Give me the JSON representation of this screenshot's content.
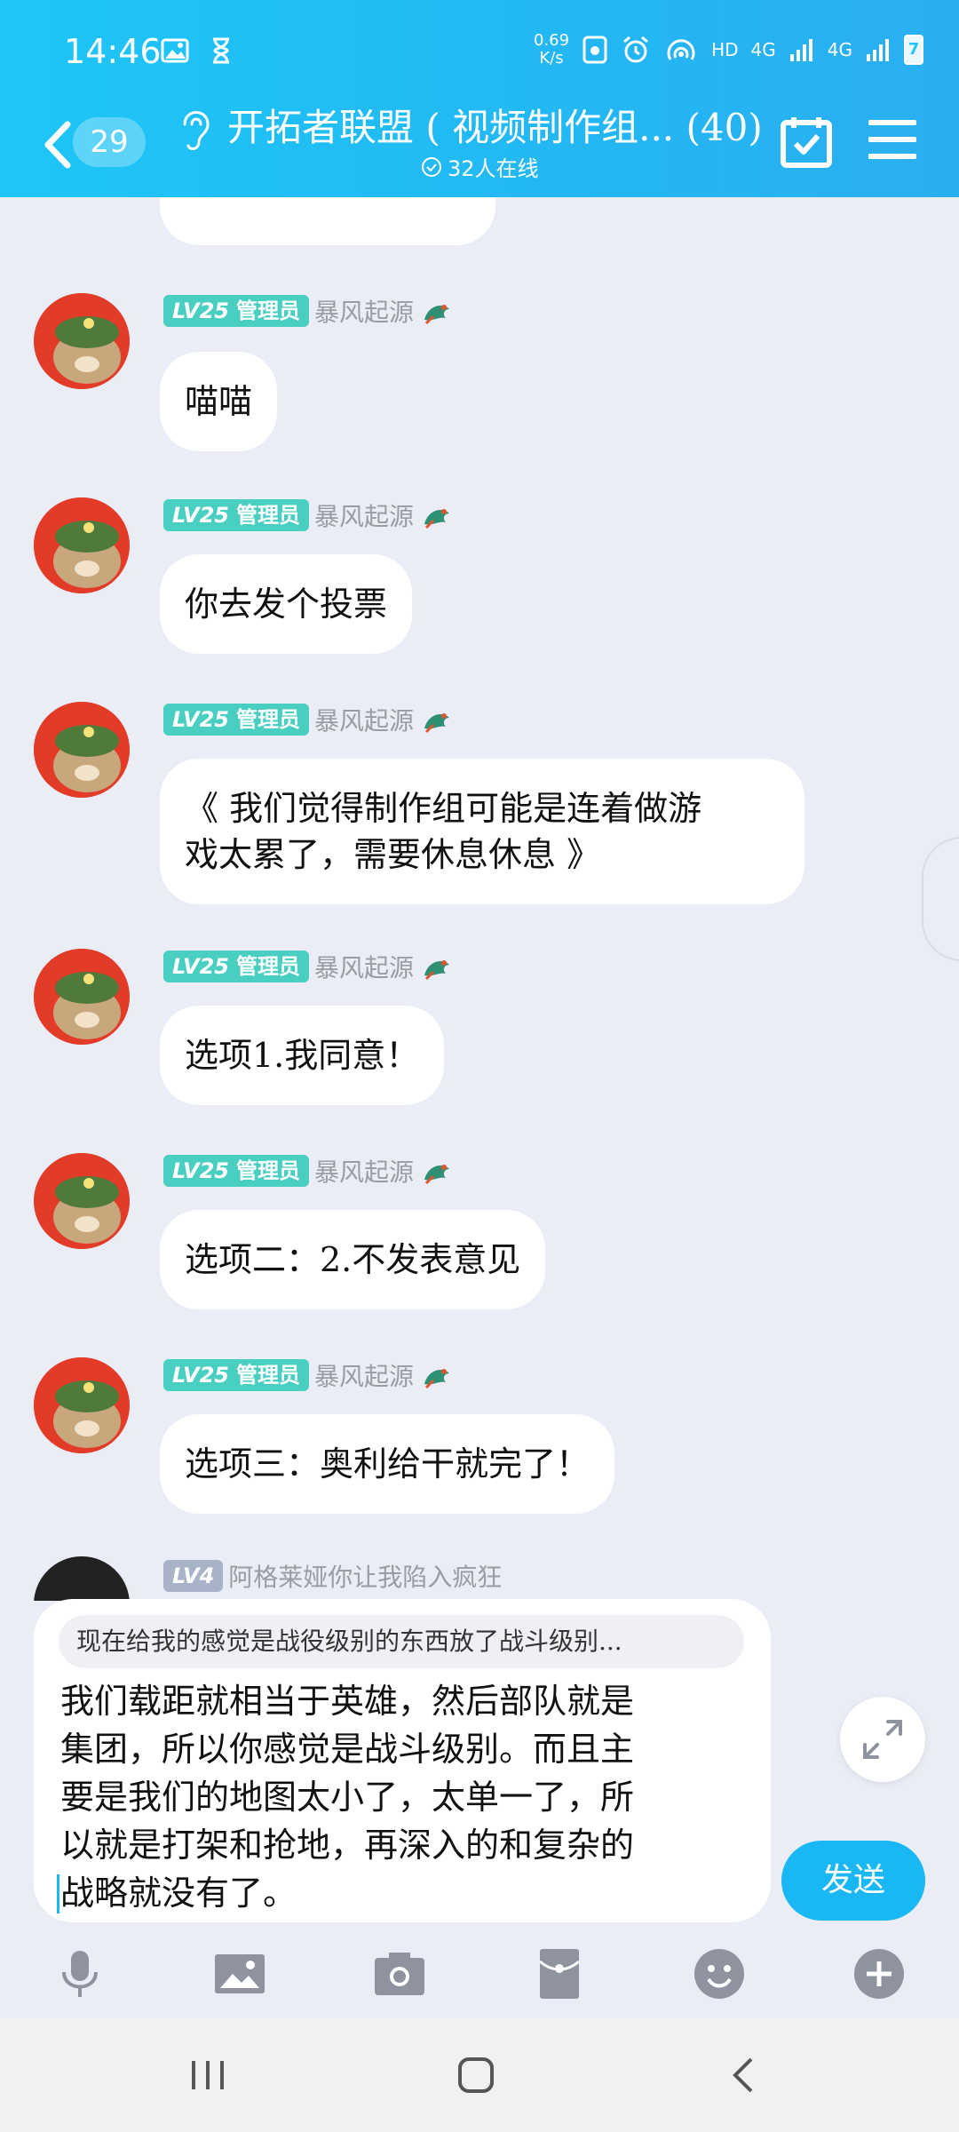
{
  "status_bar": {
    "time": "14:46",
    "net_speed_value": "0.69",
    "net_speed_unit": "K/s",
    "hd": "HD",
    "net1": "4G",
    "net2": "4G",
    "battery": "7"
  },
  "header": {
    "unread_count": "29",
    "group_title": "开拓者联盟 ( 视频制作组... (40)",
    "online": "32人在线"
  },
  "messages": [
    {
      "badge_level": "LV25",
      "badge_role": "管理员",
      "sender": "暴风起源",
      "text": "喵喵"
    },
    {
      "badge_level": "LV25",
      "badge_role": "管理员",
      "sender": "暴风起源",
      "text": "你去发个投票"
    },
    {
      "badge_level": "LV25",
      "badge_role": "管理员",
      "sender": "暴风起源",
      "text_line1": "《 我们觉得制作组可能是连着做游",
      "text_line2": "戏太累了，需要休息休息 》"
    },
    {
      "badge_level": "LV25",
      "badge_role": "管理员",
      "sender": "暴风起源",
      "text": "选项1.我同意！"
    },
    {
      "badge_level": "LV25",
      "badge_role": "管理员",
      "sender": "暴风起源",
      "text": "选项二：2.不发表意见"
    },
    {
      "badge_level": "LV25",
      "badge_role": "管理员",
      "sender": "暴风起源",
      "text": "选项三：奥利给干就完了！"
    },
    {
      "badge_level": "LV4",
      "sender": "阿格莱娅你让我陷入疯狂"
    }
  ],
  "input": {
    "quote": "现在给我的感觉是战役级别的东西放了战斗级别...",
    "line1": "我们载距就相当于英雄，然后部队就是",
    "line2": "集团，所以你感觉是战斗级别。而且主",
    "line3": "要是我们的地图太小了，太单一了，所",
    "line4": "以就是打架和抢地，再深入的和复杂的",
    "line5": "战略就没有了。"
  },
  "send_label": "发送",
  "toolbar_icons": [
    "mic-icon",
    "image-icon",
    "camera-icon",
    "red-packet-icon",
    "emoji-icon",
    "plus-icon"
  ],
  "colors": {
    "header": "#1ec6f7",
    "send": "#19b8f5",
    "badge": "#49cfc2",
    "bg": "#eaedf5"
  }
}
